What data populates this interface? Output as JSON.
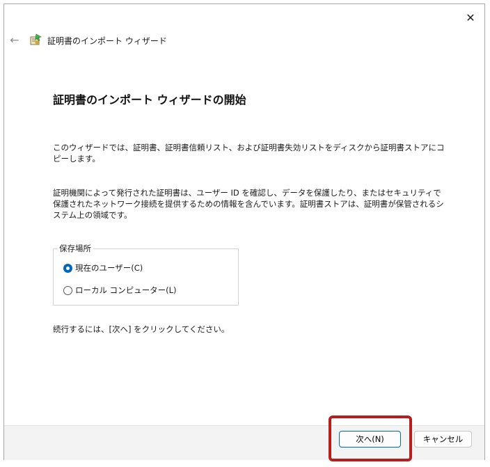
{
  "window": {
    "title": "証明書のインポート ウィザード",
    "close_icon": "close-icon",
    "back_icon": "back-arrow-icon",
    "app_icon": "certificate-wizard-icon"
  },
  "content": {
    "heading": "証明書のインポート ウィザードの開始",
    "paragraph1": "このウィザードでは、証明書、証明書信頼リスト、および証明書失効リストをディスクから証明書ストアにコピーします。",
    "paragraph2": "証明機関によって発行された証明書は、ユーザー ID を確認し、データを保護したり、またはセキュリティで保護されたネットワーク接続を提供するための情報を含んでいます。証明書ストアは、証明書が保管されるシステム上の領域です。",
    "store_location": {
      "label": "保存場所",
      "options": [
        {
          "label": "現在のユーザー(C)",
          "selected": true
        },
        {
          "label": "ローカル コンピューター(L)",
          "selected": false
        }
      ]
    },
    "paragraph3": "続行するには、[次へ] をクリックしてください。"
  },
  "footer": {
    "next_label": "次へ(N)",
    "cancel_label": "キャンセル"
  },
  "colors": {
    "accent": "#0067c0",
    "highlight": "#b81c1c"
  }
}
